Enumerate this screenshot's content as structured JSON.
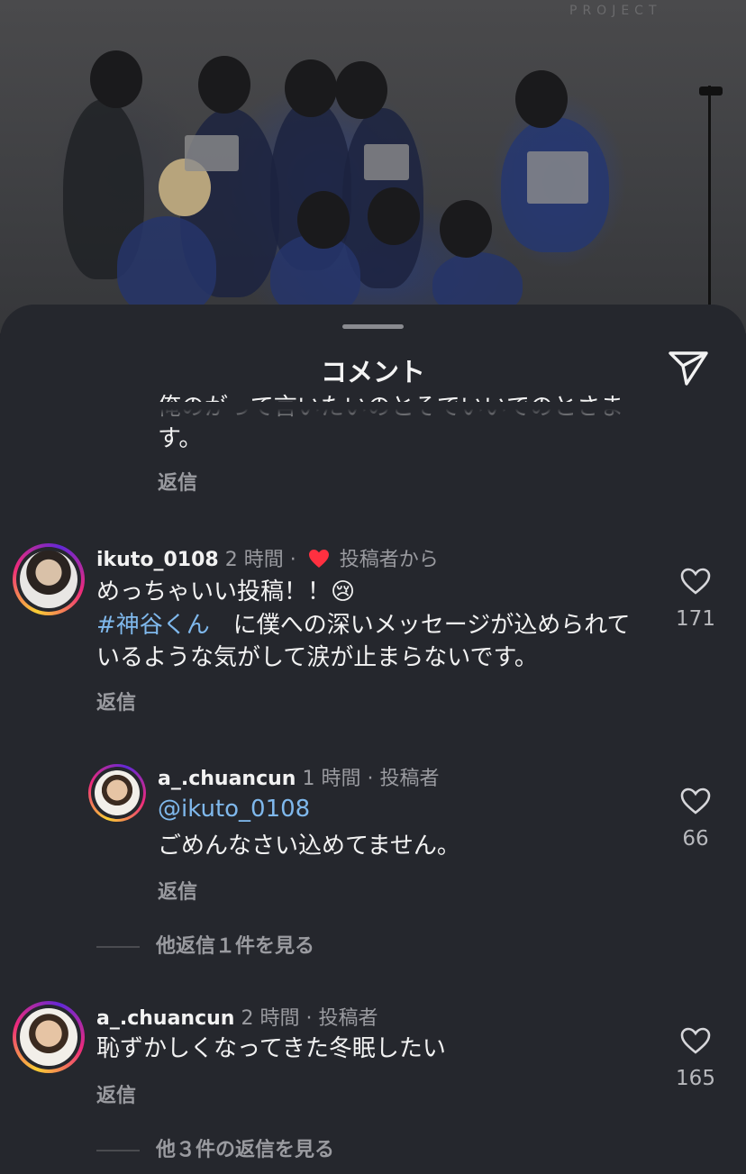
{
  "photo": {
    "watermark": "PROJECT"
  },
  "sheet": {
    "title": "コメント"
  },
  "truncated_comment": {
    "line1": "俺のがって言いたいのとそでいいでのとさま",
    "line2": "す。",
    "reply": "返信"
  },
  "comments": [
    {
      "user": "ikuto_0108",
      "time": "2 時間",
      "sep": "·",
      "badge": "投稿者から",
      "line1": "めっちゃいい投稿！！😢",
      "hashtag": "#神谷くん",
      "line2_rest": "　に僕への深いメッセージが込められて",
      "line3": "いるような気がして涙が止まらないです。",
      "reply": "返信",
      "likes": "171"
    },
    {
      "user": "a_.chuancun",
      "time": "1 時間",
      "sep": "·",
      "badge": "投稿者",
      "mention": "@ikuto_0108",
      "line2": "ごめんなさい込めてません。",
      "reply": "返信",
      "likes": "66"
    },
    {
      "user": "a_.chuancun",
      "time": "2 時間",
      "sep": "·",
      "badge": "投稿者",
      "line1": "恥ずかしくなってきた冬眠したい",
      "reply": "返信",
      "likes": "165"
    }
  ],
  "view_more": [
    "他返信１件を見る",
    "他３件の返信を見る"
  ],
  "colors": {
    "accent_link": "#7fb8ec",
    "heart_red": "#ff3040",
    "background": "#25272d"
  },
  "icons": [
    "send-icon",
    "heart-outline-icon",
    "heart-filled-icon"
  ]
}
